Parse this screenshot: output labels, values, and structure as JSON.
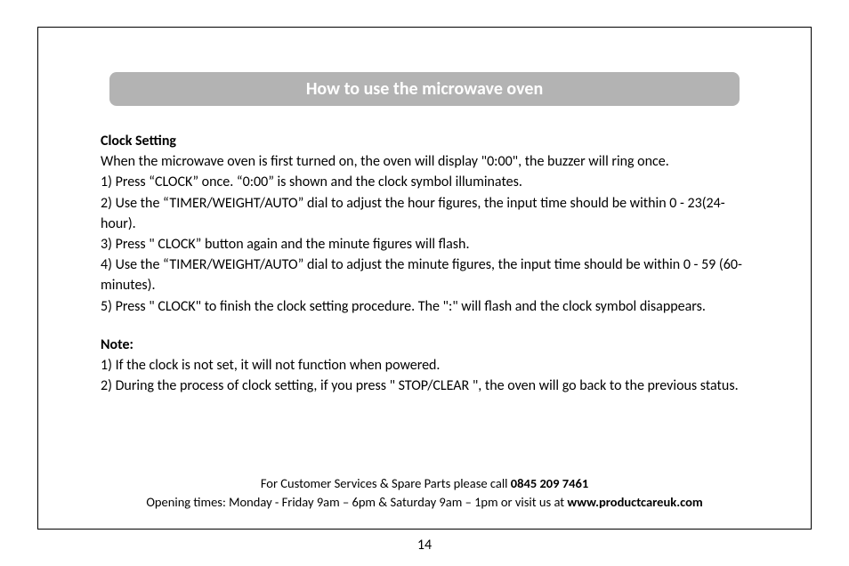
{
  "banner": {
    "title": "How to use the microwave oven"
  },
  "clock": {
    "heading": "Clock Setting",
    "intro": "When the microwave oven is first turned on, the oven will display \"0:00\", the buzzer will ring once.",
    "steps": [
      "1) Press “CLOCK” once. “0:00” is shown and the clock symbol illuminates.",
      "2) Use the “TIMER/WEIGHT/AUTO” dial to adjust the hour figures, the input time should be within 0 - 23(24-hour).",
      "3) Press \" CLOCK” button again and the minute figures will flash.",
      "4) Use the “TIMER/WEIGHT/AUTO” dial to adjust the minute figures, the input time should be within  0 - 59 (60-minutes).",
      "5) Press \" CLOCK\" to finish the clock setting procedure. The \":\" will flash and the clock symbol disappears."
    ]
  },
  "note": {
    "heading": "Note:",
    "items": [
      "1) If the clock is not set, it will not function when powered.",
      "2) During the process of clock setting, if you press \" STOP/CLEAR \", the oven will go back to the previous status."
    ]
  },
  "footer": {
    "line1_pre": "For Customer Services & Spare Parts please call ",
    "phone": "0845 209 7461",
    "line2_pre": "Opening times: Monday - Friday  9am – 6pm & Saturday 9am – 1pm or visit us at ",
    "website": "www.productcareuk.com"
  },
  "page_number": "14"
}
